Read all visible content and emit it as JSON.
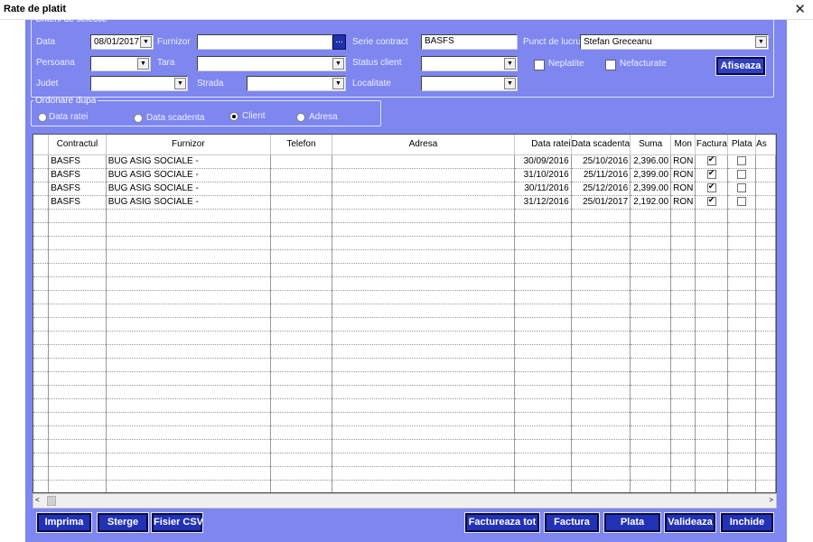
{
  "window": {
    "title": "Rate de platit",
    "close_glyph": "✕"
  },
  "criteria": {
    "legend": "Criterii de selectie",
    "data_label": "Data",
    "data_value": "08/01/2017",
    "furnizor_label": "Furnizor",
    "furnizor_value": "",
    "dots": "...",
    "serie_label": "Serie contract",
    "serie_value": "BASFS",
    "punct_label": "Punct de lucru",
    "punct_value": "Stefan Greceanu",
    "persoana_label": "Persoana",
    "tara_label": "Tara",
    "status_label": "Status client",
    "neplatite_label": "Neplatite",
    "nefacturate_label": "Nefacturate",
    "afiseaza_label": "Afiseaza",
    "judet_label": "Judet",
    "strada_label": "Strada",
    "localitate_label": "Localitate"
  },
  "order": {
    "legend": "Ordonare dupa",
    "options": [
      "Data ratei",
      "Data scadenta",
      "Client",
      "Adresa"
    ],
    "selected": "Client"
  },
  "grid": {
    "columns": [
      "Contractul",
      "Furnizor",
      "Telefon",
      "Adresa",
      "Data ratei",
      "Data scadenta",
      "Suma",
      "Mon",
      "Factura",
      "Plata",
      "As"
    ],
    "rows": [
      {
        "contract": "BASFS",
        "furnizor": "BUG ASIG SOCIALE -",
        "telefon": "",
        "adresa": "",
        "data_ratei": "30/09/2016",
        "data_scadenta": "25/10/2016",
        "suma": "2,396.00",
        "mon": "RON",
        "factura": true,
        "plata": false
      },
      {
        "contract": "BASFS",
        "furnizor": "BUG ASIG SOCIALE -",
        "telefon": "",
        "adresa": "",
        "data_ratei": "31/10/2016",
        "data_scadenta": "25/11/2016",
        "suma": "2,399.00",
        "mon": "RON",
        "factura": true,
        "plata": false
      },
      {
        "contract": "BASFS",
        "furnizor": "BUG ASIG SOCIALE -",
        "telefon": "",
        "adresa": "",
        "data_ratei": "30/11/2016",
        "data_scadenta": "25/12/2016",
        "suma": "2,399.00",
        "mon": "RON",
        "factura": true,
        "plata": false
      },
      {
        "contract": "BASFS",
        "furnizor": "BUG ASIG SOCIALE -",
        "telefon": "",
        "adresa": "",
        "data_ratei": "31/12/2016",
        "data_scadenta": "25/01/2017",
        "suma": "2,192.00",
        "mon": "RON",
        "factura": true,
        "plata": false
      }
    ]
  },
  "scroll": {
    "left_glyph": "<",
    "right_glyph": ">"
  },
  "actions": {
    "imprima": "Imprima",
    "sterge": "Sterge",
    "fisier_csv": "Fisier CSV",
    "factureaza_tot": "Factureaza tot",
    "factura": "Factura",
    "plata": "Plata",
    "valideaza": "Valideaza",
    "inchide": "Inchide"
  },
  "colors": {
    "panel": "#7e86f0",
    "button": "#2232b4"
  }
}
